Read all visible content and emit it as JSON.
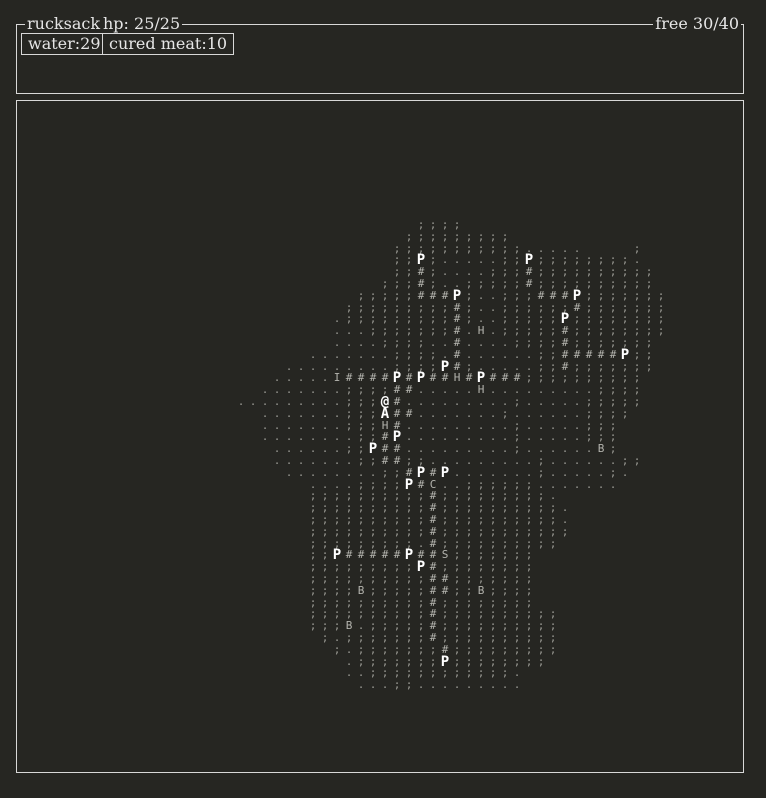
{
  "rucksack": {
    "title": "rucksack",
    "hp": "hp: 25/25",
    "free": "free 30/40",
    "items": [
      {
        "label": "water:29"
      },
      {
        "label": "cured meat:10"
      }
    ]
  },
  "map": {
    "rows": [
      "                  ;;;;                    ",
      "                 ;;;;;;;;;               ",
      "                ;;;;;;;;;;;.....    ;     ",
      "                ;;P;.....;;P;;;;;;;;.     ",
      "                ;;#;....;;;#;;;;;;;;;;    ",
      "               ;;;#;..;;;;;#;;;;;;;;;;    ",
      "             ;;;;;###P;..;;;###P;;;;;;;   ",
      "            ;;;;;;;;;#;..;;;;;;#;;;;;;;   ",
      "           .;;;;;;;;;#;..;;;;;P;;;;;;;;   ",
      "           ...;;;;;;;#.H.;;;;;#;;;;;;;;   ",
      "           ....;;;;..#....;;;;#;;;;;;;   ",
      "         .......;;;;.#......;;#####P;;   ",
      "       .........;;;;P#;.....;;#;;;;;;;   ",
      "      .....I####P#P##H#P###;;;;;;;;;;   ",
      "     .......;;;;##.....H.........;;;;   ",
      "   .........;;;@#.........;.....;;;;;    ",
      "     .......;;;A##.......;......;;;;    ",
      "     .......;;;H#.........;.....;;;     ",
      "     ........;;#P.........;.....;;;     ",
      "      ......;;P##.........;......B;     ",
      "      .......;;##;;.........;......;;    ",
      "       ........;;#P#P.......;.....;.    ",
      "         ....;;;;P#C..;;;;;;.......     ",
      "         ;;;;;;;;;;#;;;;;;;;;.          ",
      "         ;;;;;;;;;;#;;;;;;;;;;.         ",
      "         ;;;;;;;;;;#;;;;;;;;;;.         ",
      "         ;;;;;;;;;;#;;;;;;;;;;;         ",
      "         ;;;;;;;;;.#;;;;;;;;;;          ",
      "         ;;P#####P##S;;;;;;;           ",
      "         ;;;;;;;;;P#;;;;;;;;           ",
      "         ;;;;;;;;;;##;;;;;;;           ",
      "         ;;;;B;;;;;##;;B;;;;           ",
      "         ;;;;;;;;;;#;;;;;;;;           ",
      "         ;;;;;;;;;;#;;;;;;;;;;         ",
      "         ;;;B.;;;;;#;;;;;;;;;;         ",
      "          ;.;;;;;;;#;;;;;;;;;;         ",
      "           ;.;;;;;;;#;;;;;;;;;         ",
      "            .;;;;;;;P;;;;;;;;          ",
      "            ..;;;;;;;;;;;;.            ",
      "             ...;;.........            "
    ]
  }
}
